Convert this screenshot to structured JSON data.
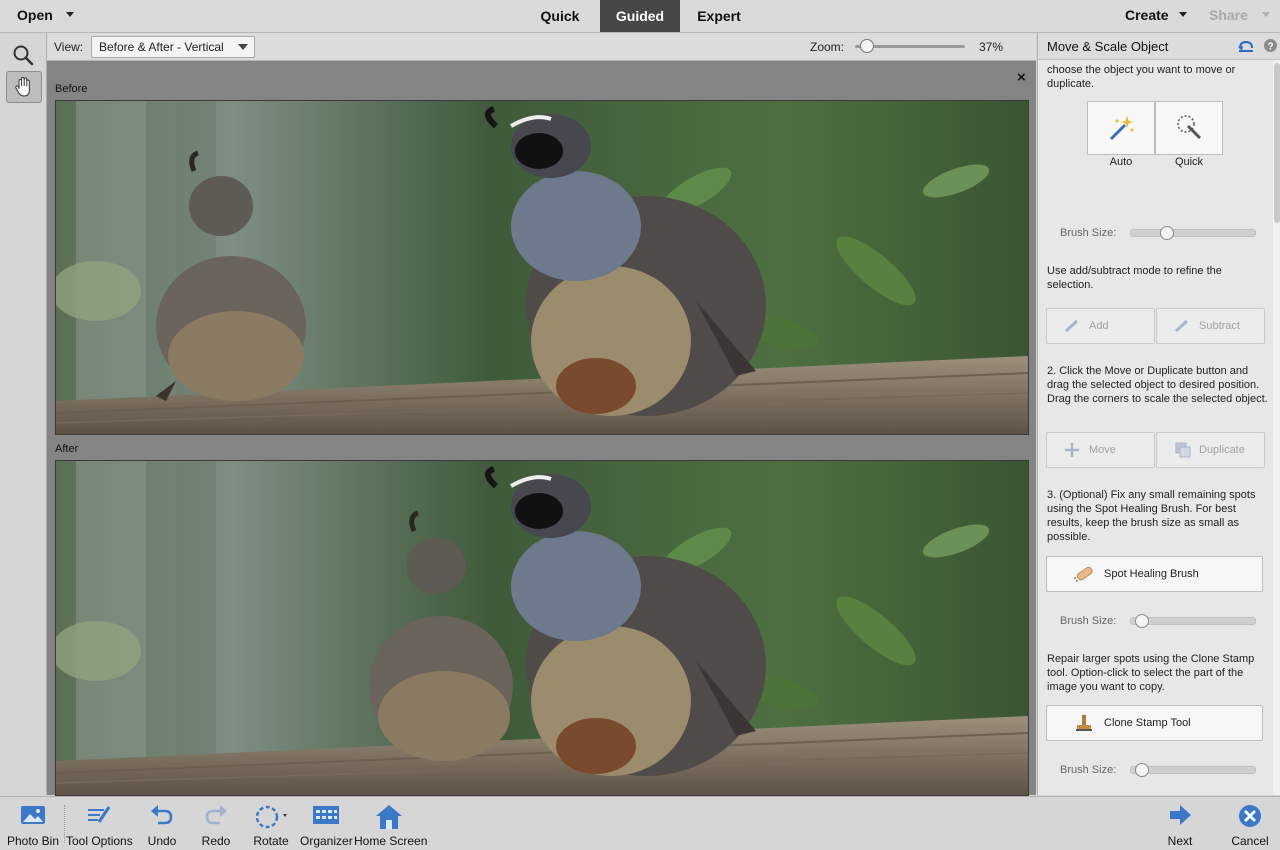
{
  "topbar": {
    "open_label": "Open",
    "modes": [
      {
        "label": "Quick",
        "active": false
      },
      {
        "label": "Guided",
        "active": true
      },
      {
        "label": "Expert",
        "active": false
      }
    ],
    "create_label": "Create",
    "share_label": "Share"
  },
  "tools": [
    {
      "icon": "zoom-icon",
      "selected": false
    },
    {
      "icon": "hand-icon",
      "selected": true
    }
  ],
  "options": {
    "view_label": "View:",
    "view_value": "Before & After - Vertical",
    "zoom_label": "Zoom:",
    "zoom_value": "37%",
    "zoom_fraction": 0.1
  },
  "canvas": {
    "before_label": "Before",
    "after_label": "After",
    "close_symbol": "×"
  },
  "panel": {
    "title": "Move & Scale Object",
    "step1_text": "choose the object you want to move or duplicate.",
    "auto_label": "Auto",
    "quick_label": "Quick",
    "brush_size_label": "Brush Size:",
    "refine_text": "Use add/subtract mode to refine the selection.",
    "add_label": "Add",
    "subtract_label": "Subtract",
    "step2_text": "2. Click the Move or Duplicate button and drag the selected object to desired position. Drag the corners to scale the selected object.",
    "move_label": "Move",
    "duplicate_label": "Duplicate",
    "step3_text": "3. (Optional) Fix any small remaining spots using the Spot Healing Brush. For best results, keep the brush size as small as possible.",
    "spot_healing_label": "Spot Healing Brush",
    "clone_text": "Repair larger spots using the Clone Stamp tool. Option-click to select the part of the image you want to copy.",
    "clone_stamp_label": "Clone Stamp Tool"
  },
  "bottombar": {
    "photo_bin": "Photo Bin",
    "tool_options": "Tool Options",
    "undo": "Undo",
    "redo": "Redo",
    "rotate": "Rotate",
    "organizer": "Organizer",
    "home_screen": "Home Screen",
    "next": "Next",
    "cancel": "Cancel"
  },
  "colors": {
    "accent_blue": "#2a6cc4",
    "active_tab": "#474747"
  }
}
